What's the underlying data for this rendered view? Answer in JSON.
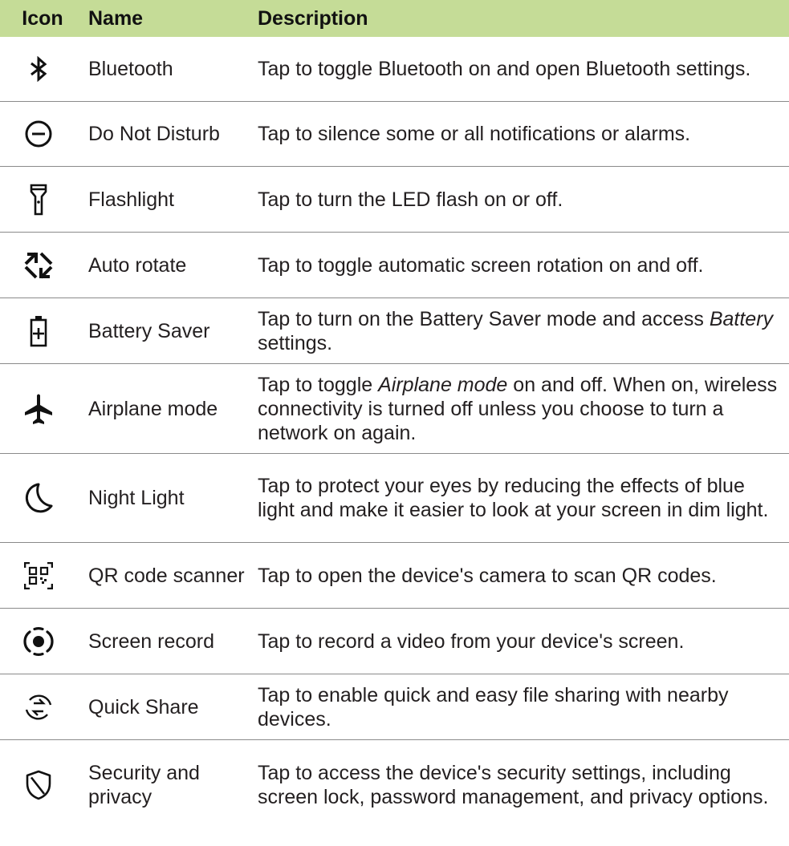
{
  "header": {
    "icon": "Icon",
    "name": "Name",
    "description": "Description"
  },
  "rows": [
    {
      "icon": "bluetooth-icon",
      "name": "Bluetooth",
      "description": "Tap to toggle Bluetooth on and open Bluetooth settings."
    },
    {
      "icon": "do-not-disturb-icon",
      "name": "Do Not Disturb",
      "description": "Tap to silence some or all notifications or alarms."
    },
    {
      "icon": "flashlight-icon",
      "name": "Flashlight",
      "description": "Tap to turn the LED flash on or off."
    },
    {
      "icon": "auto-rotate-icon",
      "name": "Auto rotate",
      "description": "Tap to toggle automatic screen rotation on and off."
    },
    {
      "icon": "battery-saver-icon",
      "name": "Battery Saver",
      "desc_before": "Tap to turn on the Battery Saver mode and access ",
      "desc_em": "Battery",
      "desc_after": " settings."
    },
    {
      "icon": "airplane-icon",
      "name": "Airplane mode",
      "desc_before": "Tap to toggle ",
      "desc_em": "Airplane mode",
      "desc_after": " on and off. When on, wireless connectivity is turned off unless you choose to turn a network on again."
    },
    {
      "icon": "night-light-icon",
      "name": "Night Light",
      "description": "Tap to protect your eyes by reducing the effects of blue light and make it easier to look at your screen in dim light."
    },
    {
      "icon": "qr-code-scanner-icon",
      "name": "QR code scanner",
      "description": "Tap to open the device's camera to scan QR codes."
    },
    {
      "icon": "screen-record-icon",
      "name": "Screen record",
      "description": "Tap to record a video from your device's screen."
    },
    {
      "icon": "quick-share-icon",
      "name": "Quick Share",
      "description": "Tap to enable quick and easy file sharing with nearby devices."
    },
    {
      "icon": "security-privacy-icon",
      "name": "Security and privacy",
      "description": "Tap to access the device's security settings, including screen lock, password management, and privacy options."
    }
  ]
}
